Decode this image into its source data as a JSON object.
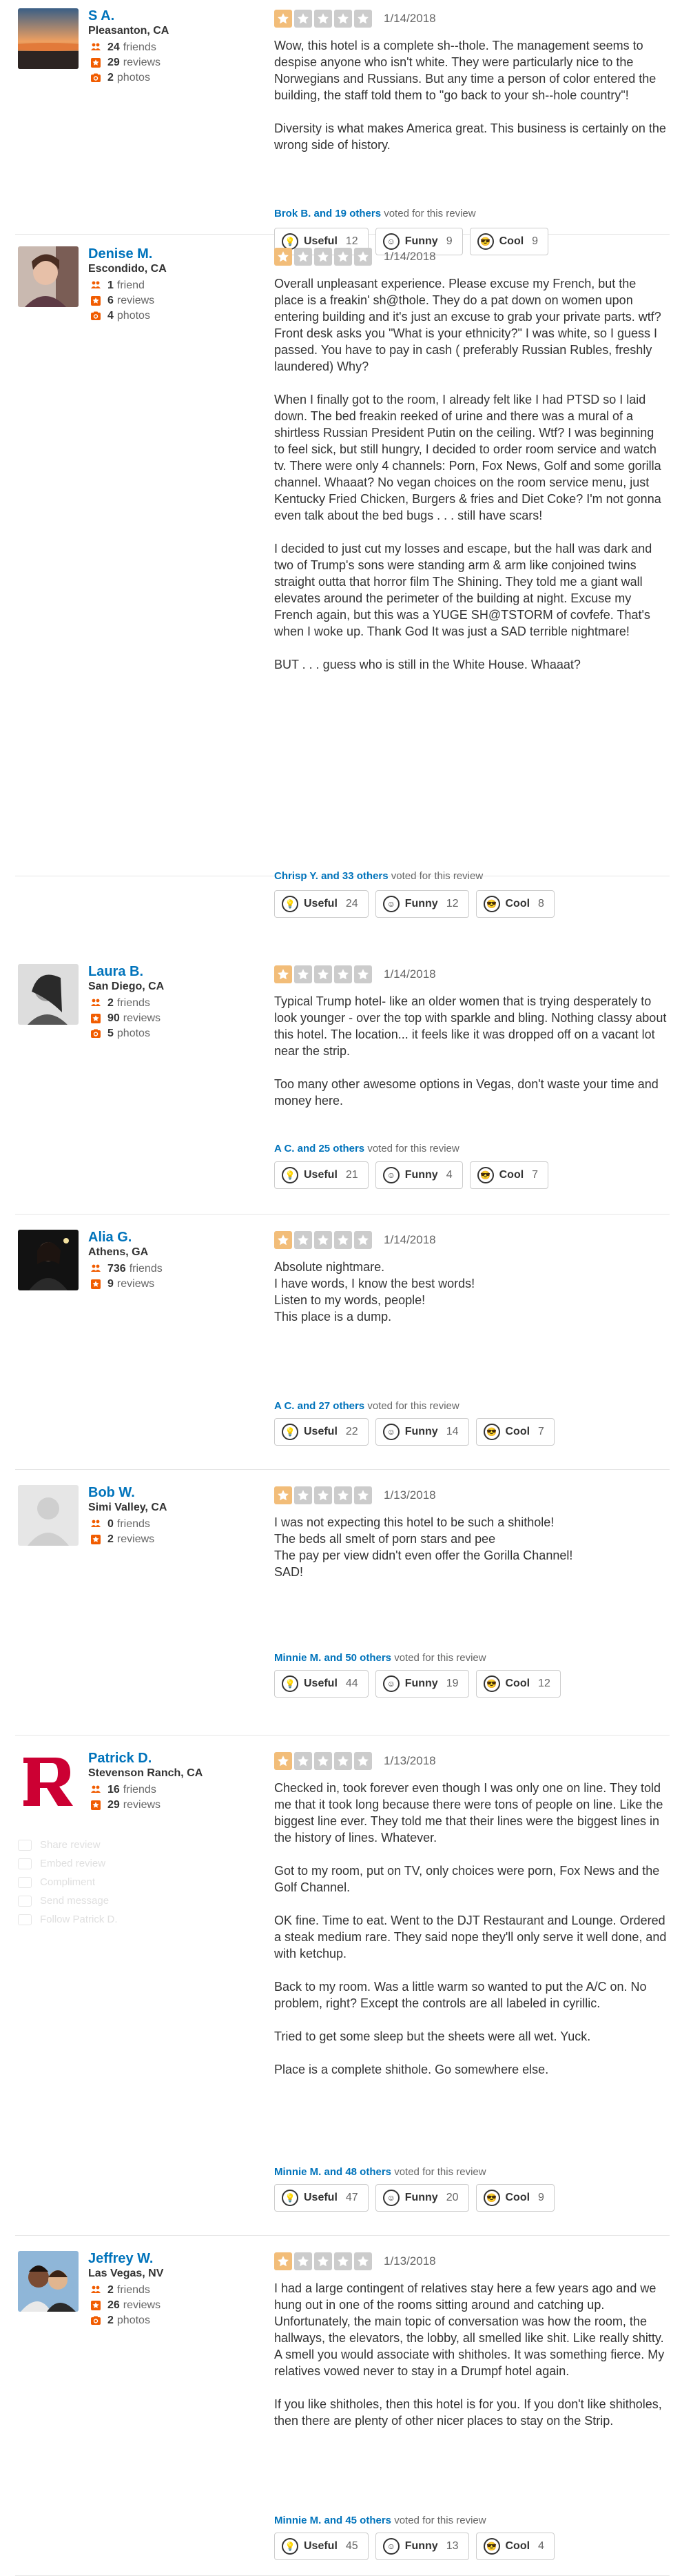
{
  "colors": {
    "link": "#0073bb",
    "star_on": "#f2bd79",
    "star_off": "#cccccc",
    "friends": "#f15c00",
    "reviews": "#f15c00",
    "photos": "#f15c00"
  },
  "icons": {
    "friends": "friends-icon",
    "reviews": "star-icon",
    "photos": "camera-icon",
    "useful": "lightbulb-icon",
    "funny": "smile-icon",
    "cool": "sunglasses-icon"
  },
  "reviews": [
    {
      "name": "S A.",
      "location": "Pleasanton, CA",
      "friends": "24",
      "friends_label": "friends",
      "reviews": "29",
      "reviews_label": "reviews",
      "photos": "2",
      "photos_label": "photos",
      "rating": 1,
      "date": "1/14/2018",
      "paragraphs": [
        "Wow, this hotel is a complete sh--thole. The management seems to despise anyone who isn't white. They were particularly nice to the Norwegians and Russians. But any time a person of color entered the building, the staff told them to \"go back to your sh--hole country\"!",
        "Diversity is what makes America great. This business is certainly on the wrong side of history."
      ],
      "voted_names": "Brok B. and 19 others",
      "voted_suffix": "voted for this review",
      "useful": "12",
      "funny": "9",
      "cool": "9"
    },
    {
      "name": "Denise M.",
      "location": "Escondido, CA",
      "friends": "1",
      "friends_label": "friend",
      "reviews": "6",
      "reviews_label": "reviews",
      "photos": "4",
      "photos_label": "photos",
      "rating": 1,
      "date": "1/14/2018",
      "paragraphs": [
        "Overall unpleasant experience.  Please excuse my French, but the place is a freakin' sh@thole.  They do a pat down on women upon entering building and it's just an excuse to grab your private parts. wtf?  Front desk asks you \"What is your ethnicity?\"   I was white, so I guess I passed.  You have to pay in cash ( preferably Russian Rubles, freshly laundered) Why?",
        "When I finally got to the room, I already felt like I had PTSD so I laid down.  The bed freakin reeked of urine and there was a mural of a shirtless Russian President Putin on the ceiling. Wtf? I was beginning to feel sick, but still hungry, I decided to order room service and watch tv.  There were only 4 channels:  Porn, Fox News, Golf and some gorilla channel. Whaaat?  No vegan choices on the room service menu, just Kentucky Fried Chicken, Burgers & fries and Diet Coke? I'm not gonna even talk about the bed bugs . . . still have scars!",
        "I decided to just cut my losses and escape, but the hall was dark and two of Trump's sons were standing arm & arm like conjoined twins straight outta that horror film The Shining. They told me a giant wall elevates around the perimeter of the building at night. Excuse my French again, but this was a YUGE SH@TSTORM of covfefe.  That's when I woke up.  Thank God It was just a SAD terrible nightmare!",
        "BUT . . . guess who is still in the White House. Whaaat?"
      ],
      "voted_names": "Chrisp Y. and 33 others",
      "voted_suffix": "voted for this review",
      "useful": "24",
      "funny": "12",
      "cool": "8"
    },
    {
      "name": "Laura B.",
      "location": "San Diego, CA",
      "friends": "2",
      "friends_label": "friends",
      "reviews": "90",
      "reviews_label": "reviews",
      "photos": "5",
      "photos_label": "photos",
      "rating": 1,
      "date": "1/14/2018",
      "paragraphs": [
        "Typical Trump hotel- like an older women that is trying desperately to look younger -  over the top with sparkle and bling.  Nothing classy about this hotel.  The location...  it feels like it was dropped off on a vacant lot near the strip.",
        "Too many other awesome options in Vegas, don't waste your time and money here."
      ],
      "voted_names": "A C. and 25 others",
      "voted_suffix": "voted for this review",
      "useful": "21",
      "funny": "4",
      "cool": "7"
    },
    {
      "name": "Alia G.",
      "location": "Athens, GA",
      "friends": "736",
      "friends_label": "friends",
      "reviews": "9",
      "reviews_label": "reviews",
      "photos": "",
      "photos_label": "",
      "rating": 1,
      "date": "1/14/2018",
      "paragraphs": [
        "Absolute nightmare.\nI have words, I know the best words!\nListen to my words, people!\nThis place is a dump."
      ],
      "voted_names": "A C. and 27 others",
      "voted_suffix": "voted for this review",
      "useful": "22",
      "funny": "14",
      "cool": "7"
    },
    {
      "name": "Bob W.",
      "location": "Simi Valley, CA",
      "friends": "0",
      "friends_label": "friends",
      "reviews": "2",
      "reviews_label": "reviews",
      "photos": "",
      "photos_label": "",
      "rating": 1,
      "date": "1/13/2018",
      "paragraphs": [
        "I was not expecting this hotel to be such a shithole!\nThe beds all smelt of porn stars and pee\nThe pay per view didn't even offer the Gorilla Channel!\nSAD!"
      ],
      "voted_names": "Minnie M. and 50 others",
      "voted_suffix": "voted for this review",
      "useful": "44",
      "funny": "19",
      "cool": "12"
    },
    {
      "name": "Patrick D.",
      "location": "Stevenson Ranch, CA",
      "friends": "16",
      "friends_label": "friends",
      "reviews": "29",
      "reviews_label": "reviews",
      "photos": "",
      "photos_label": "",
      "rating": 1,
      "date": "1/13/2018",
      "paragraphs": [
        "Checked in, took forever even though I was only one on line. They told me that it took long because there were tons of people on line. Like the biggest line ever. They told me that their lines were the biggest lines in the history of lines. Whatever.",
        "Got to my room, put on TV, only choices were porn, Fox News and the Golf Channel.",
        "OK fine. Time to eat. Went to the DJT Restaurant and Lounge. Ordered a steak medium rare. They said nope they'll only serve it well done, and with ketchup.",
        "Back to my room. Was a little warm so wanted to put the A/C on. No problem, right? Except the controls are all labeled in cyrillic.",
        "Tried to get some sleep but the sheets were all wet. Yuck.",
        "Place is a complete shithole. Go somewhere else."
      ],
      "voted_names": "Minnie M. and 48 others",
      "voted_suffix": "voted for this review",
      "useful": "47",
      "funny": "20",
      "cool": "9"
    },
    {
      "name": "Jeffrey W.",
      "location": "Las Vegas, NV",
      "friends": "2",
      "friends_label": "friends",
      "reviews": "26",
      "reviews_label": "reviews",
      "photos": "2",
      "photos_label": "photos",
      "rating": 1,
      "date": "1/13/2018",
      "paragraphs": [
        "I had a large contingent of relatives stay here a few years ago and we hung out in one of the rooms sitting around and catching up. Unfortunately, the main topic of conversation was how the room, the hallways, the elevators, the lobby, all smelled like shit. Like really shitty. A smell you would associate with shitholes. It was something fierce. My relatives vowed never to stay in a Drumpf hotel again.",
        "If you like shitholes, then this hotel is for you. If you don't like shitholes, then there are plenty of other nicer places to stay on the Strip."
      ],
      "voted_names": "Minnie M. and 45 others",
      "voted_suffix": "voted for this review",
      "useful": "45",
      "funny": "13",
      "cool": "4"
    }
  ],
  "vote_labels": {
    "useful": "Useful",
    "funny": "Funny",
    "cool": "Cool"
  },
  "faded_menu": [
    "Share review",
    "Embed review",
    "Compliment",
    "Send message",
    "Follow Patrick D."
  ]
}
